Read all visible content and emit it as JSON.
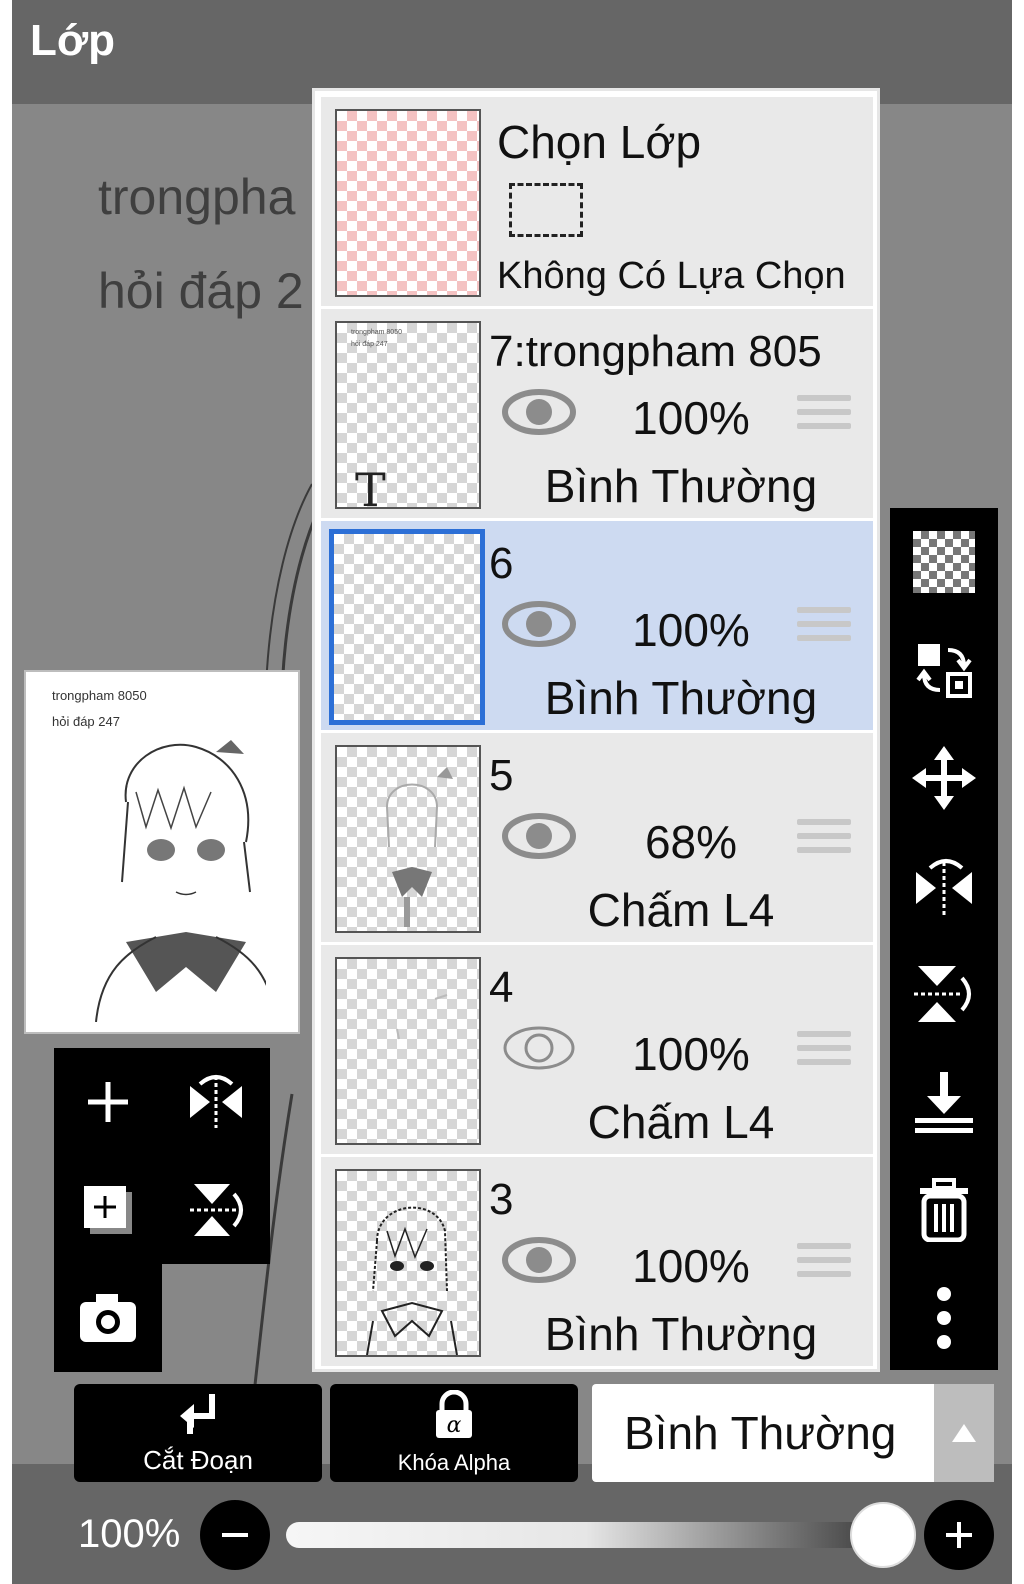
{
  "app": {
    "title": "Lớp"
  },
  "canvas": {
    "text_line1": "trongpha",
    "text_line2": "hỏi đáp 2"
  },
  "preview": {
    "line1": "trongpham 8050",
    "line2": "hỏi đáp 247"
  },
  "selection_layer": {
    "title": "Chọn Lớp",
    "status": "Không Có Lựa Chọn"
  },
  "layers": [
    {
      "name": "7:trongpham 805",
      "opacity": "100%",
      "blend": "Bình Thường",
      "visible": true,
      "selected": false,
      "type": "text",
      "thumb_line1": "trongpham 8050",
      "thumb_line2": "hỏi đáp 247"
    },
    {
      "name": "6",
      "opacity": "100%",
      "blend": "Bình Thường",
      "visible": true,
      "selected": true
    },
    {
      "name": "5",
      "opacity": "68%",
      "blend": "Chấm L4",
      "visible": true,
      "selected": false
    },
    {
      "name": "4",
      "opacity": "100%",
      "blend": "Chấm L4",
      "visible": false,
      "selected": false
    },
    {
      "name": "3",
      "opacity": "100%",
      "blend": "Bình Thường",
      "visible": true,
      "selected": false
    }
  ],
  "left_tools": [
    "add-layer-icon",
    "flip-horizontal-icon",
    "add-copy-layer-icon",
    "flip-vertical-icon",
    "camera-icon"
  ],
  "right_tools": [
    "transparent-fill-icon",
    "swap-icon",
    "move-icon",
    "flip-horizontal-icon",
    "flip-vertical-icon",
    "merge-down-icon",
    "trash-icon",
    "more-vertical-icon"
  ],
  "bottom": {
    "clip_label": "Cắt Đoạn",
    "alpha_lock_label": "Khóa Alpha",
    "blend_mode": "Bình Thường",
    "opacity_label": "100%",
    "opacity_value": 1.0
  },
  "colors": {
    "selected_row": "#cddaf1",
    "selected_border": "#2c6fd6",
    "toolbar": "#000000",
    "header": "#666666"
  }
}
